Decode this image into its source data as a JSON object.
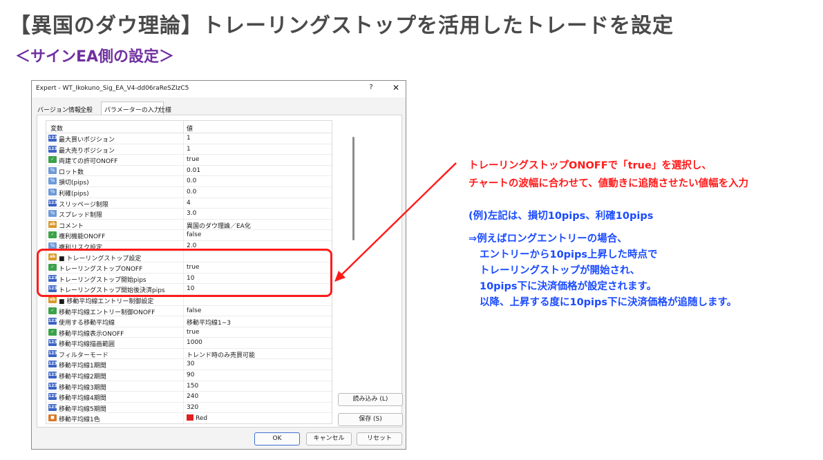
{
  "header": {
    "title": "【異国のダウ理論】トレーリングストップを活用したトレードを設定",
    "subtitle": "＜サインEA側の設定＞"
  },
  "dialog": {
    "title": "Expert - WT_Ikokuno_Sig_EA_V4-dd06raReSZIzC5",
    "help": "?",
    "close": "✕",
    "tabs": [
      "バージョン情報",
      "全般",
      "パラメーターの入力",
      "仕様"
    ],
    "grid_headers": {
      "name": "変数",
      "value": "値"
    },
    "rows": [
      {
        "icon": "123",
        "name": "最大買いポジション",
        "value": "1"
      },
      {
        "icon": "123",
        "name": "最大売りポジション",
        "value": "1"
      },
      {
        "icon": "bool",
        "name": "両建ての許可ONOFF",
        "value": "true"
      },
      {
        "icon": "½",
        "name": "ロット数",
        "value": "0.01"
      },
      {
        "icon": "½",
        "name": "損切(pips)",
        "value": "0.0"
      },
      {
        "icon": "½",
        "name": "利確(pips)",
        "value": "0.0"
      },
      {
        "icon": "123",
        "name": "スリッページ制限",
        "value": "4"
      },
      {
        "icon": "½",
        "name": "スプレッド制限",
        "value": "3.0"
      },
      {
        "icon": "ab",
        "name": "コメント",
        "value": "異国のダウ理論／EA化"
      },
      {
        "icon": "bool",
        "name": "複利機能ONOFF",
        "value": "false"
      },
      {
        "icon": "½",
        "name": "複利リスク設定",
        "value": "2.0"
      },
      {
        "icon": "ab",
        "name": "■ トレーリングストップ設定",
        "value": ""
      },
      {
        "icon": "bool",
        "name": "トレーリングストップONOFF",
        "value": "true"
      },
      {
        "icon": "123",
        "name": "トレーリングストップ開始pips",
        "value": "10"
      },
      {
        "icon": "123",
        "name": "トレーリングストップ開始後決済pips",
        "value": "10"
      },
      {
        "icon": "ab",
        "name": "■ 移動平均線エントリー制御設定",
        "value": ""
      },
      {
        "icon": "bool",
        "name": "移動平均線エントリー制御ONOFF",
        "value": "false"
      },
      {
        "icon": "123",
        "name": "使用する移動平均線",
        "value": "移動平均線1~3"
      },
      {
        "icon": "bool",
        "name": "移動平均線表示ONOFF",
        "value": "true"
      },
      {
        "icon": "123",
        "name": "移動平均線描画範囲",
        "value": "1000"
      },
      {
        "icon": "123",
        "name": "フィルターモード",
        "value": "トレンド時のみ売買可能"
      },
      {
        "icon": "123",
        "name": "移動平均線1期間",
        "value": "30"
      },
      {
        "icon": "123",
        "name": "移動平均線2期間",
        "value": "90"
      },
      {
        "icon": "123",
        "name": "移動平均線3期間",
        "value": "150"
      },
      {
        "icon": "123",
        "name": "移動平均線4期間",
        "value": "240"
      },
      {
        "icon": "123",
        "name": "移動平均線5期間",
        "value": "320"
      },
      {
        "icon": "color",
        "name": "移動平均線1色",
        "value": "Red"
      }
    ],
    "buttons": {
      "load": "読み込み (L)",
      "save": "保存 (S)",
      "ok": "OK",
      "cancel": "キャンセル",
      "reset": "リセット"
    }
  },
  "notes": {
    "red_line1": "トレーリングストップONOFFで「true」を選択し、",
    "red_line2": "チャートの波幅に合わせて、値動きに追随させたい値幅を入力",
    "blue_line1": "(例)左記は、損切10pips、利確10pips",
    "blue_line2": "⇒例えばロングエントリーの場合、",
    "blue_line3": "エントリーから10pips上昇した時点で",
    "blue_line4": "トレーリングストップが開始され、",
    "blue_line5": "10pips下に決済価格が設定されます。",
    "blue_line6": "以降、上昇する度に10pips下に決済価格が追随します。"
  },
  "colors": {
    "title": "#4a4a4a",
    "subtitle": "#7030a0",
    "highlight": "#ff1a1a",
    "note_red": "#ff1a1a",
    "note_blue": "#1a4bff"
  }
}
